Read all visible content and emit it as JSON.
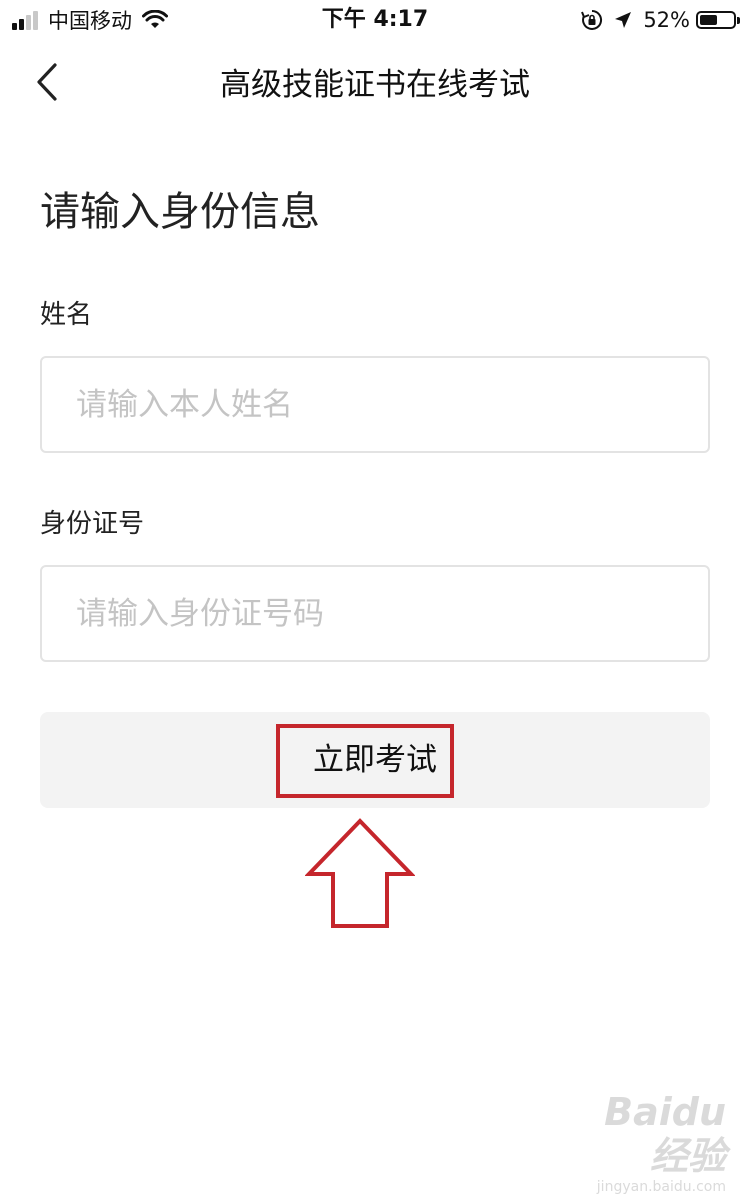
{
  "status_bar": {
    "carrier": "中国移动",
    "time": "下午 4:17",
    "battery_percent": "52%",
    "battery_level": 0.52,
    "signal_bars": 4,
    "signal_bars_filled": 2,
    "icons": [
      "signal-icon",
      "wifi-icon",
      "rotation-lock-icon",
      "location-arrow-icon",
      "battery-icon"
    ]
  },
  "nav": {
    "back_icon": "chevron-left-icon",
    "title": "高级技能证书在线考试"
  },
  "form": {
    "heading": "请输入身份信息",
    "name_label": "姓名",
    "name_placeholder": "请输入本人姓名",
    "name_value": "",
    "id_label": "身份证号",
    "id_placeholder": "请输入身份证号码",
    "id_value": "",
    "submit_label": "立即考试"
  },
  "annotation": {
    "highlight_color": "#c5262c",
    "arrow_icon": "arrow-up-outline-icon"
  },
  "watermark": {
    "logo": "Baidu经验",
    "url": "jingyan.baidu.com"
  }
}
